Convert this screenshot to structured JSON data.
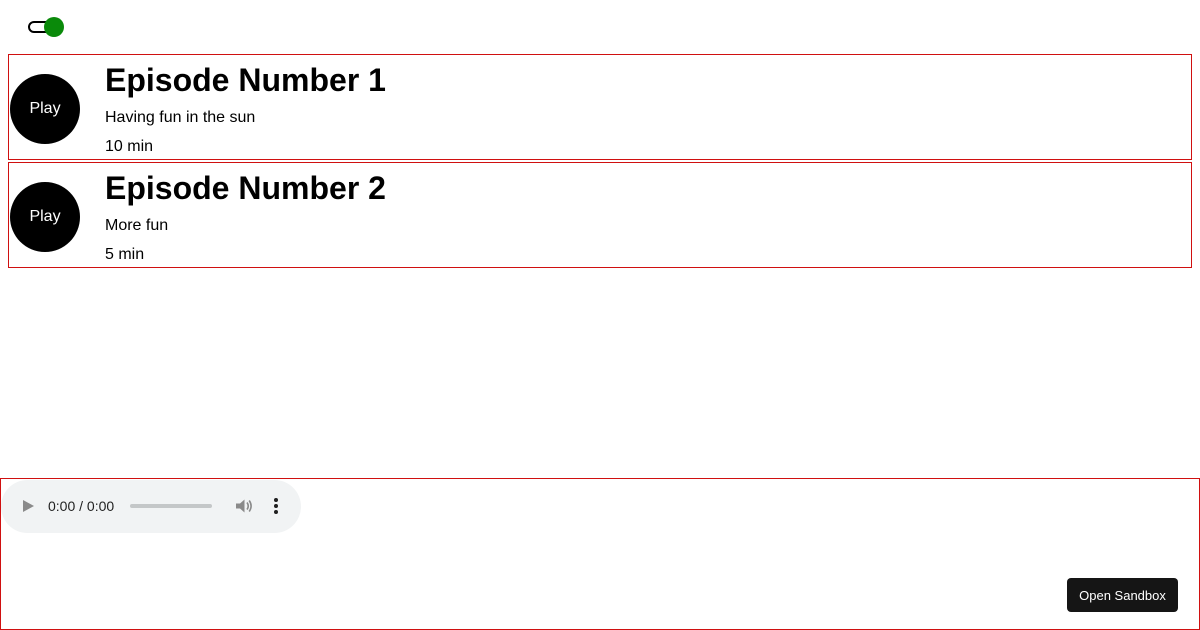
{
  "toggle": {
    "state": "on",
    "knob_color": "#0a8a0a"
  },
  "episodes": [
    {
      "play_label": "Play",
      "title": "Episode Number 1",
      "description": "Having fun in the sun",
      "duration": "10 min"
    },
    {
      "play_label": "Play",
      "title": "Episode Number 2",
      "description": "More fun",
      "duration": "5 min"
    }
  ],
  "player": {
    "time_display": "0:00 / 0:00",
    "progress": 0,
    "play_icon": "play-icon",
    "volume_icon": "volume-icon",
    "menu_icon": "more-vert-icon"
  },
  "sandbox": {
    "label": "Open Sandbox"
  },
  "colors": {
    "border": "#d01010",
    "play_button": "#000000",
    "toggle_on": "#0a8a0a",
    "sandbox_button": "#151515"
  }
}
